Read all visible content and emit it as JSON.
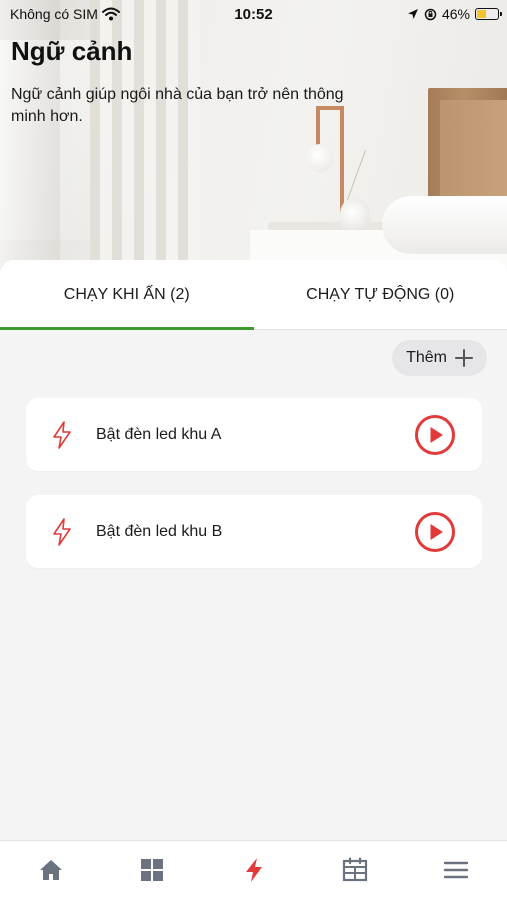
{
  "status_bar": {
    "carrier": "Không có SIM",
    "time": "10:52",
    "battery_percent": "46%",
    "battery_level": 0.46,
    "icons": [
      "wifi-icon",
      "location-arrow-icon",
      "orientation-lock-icon",
      "battery-charging-icon"
    ]
  },
  "hero": {
    "title": "Ngữ cảnh",
    "description": "Ngữ cảnh giúp ngôi nhà của bạn trở nên thông minh hơn."
  },
  "tabs": [
    {
      "label": "CHẠY KHI ẤN (2)",
      "active": true
    },
    {
      "label": "CHẠY TỰ ĐỘNG (0)",
      "active": false
    }
  ],
  "add_button": {
    "label": "Thêm",
    "icon": "plus-icon"
  },
  "scenes": [
    {
      "label": "Bật đèn led khu A",
      "icon": "lightning-icon",
      "action_icon": "play-circle-icon"
    },
    {
      "label": "Bật đèn led khu B",
      "icon": "lightning-icon",
      "action_icon": "play-circle-icon"
    }
  ],
  "bottom_nav": [
    {
      "icon": "home-icon",
      "active": false
    },
    {
      "icon": "grid-icon",
      "active": false
    },
    {
      "icon": "lightning-icon",
      "active": true
    },
    {
      "icon": "calendar-icon",
      "active": false
    },
    {
      "icon": "menu-icon",
      "active": false
    }
  ],
  "colors": {
    "accent_green": "#3c9a2e",
    "accent_red": "#e03a3a",
    "nav_gray": "#6b7380",
    "card_bg": "#ffffff",
    "page_bg": "#f4f4f5"
  }
}
